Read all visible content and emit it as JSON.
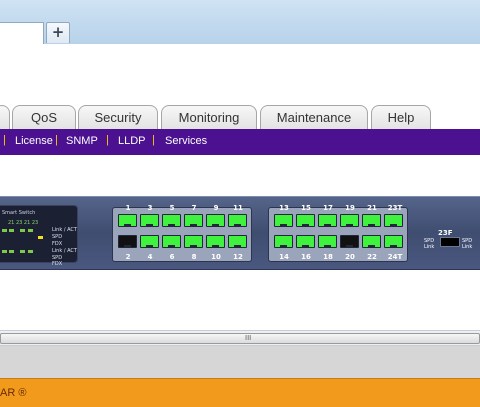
{
  "browser": {
    "new_tab_label": "+"
  },
  "nav": {
    "tabs": [
      {
        "label": ""
      },
      {
        "label": "QoS"
      },
      {
        "label": "Security"
      },
      {
        "label": "Monitoring"
      },
      {
        "label": "Maintenance"
      },
      {
        "label": "Help"
      }
    ],
    "sub_items": [
      {
        "label": "License"
      },
      {
        "label": "SNMP"
      },
      {
        "label": "LLDP"
      },
      {
        "label": "Services"
      }
    ],
    "separator": "|"
  },
  "switch": {
    "panel_title": "Smart Switch",
    "led_numbers": "21  23  21  23",
    "led_labels": [
      "Link / ACT",
      "SPD",
      "FDX",
      "Link / ACT",
      "SPD",
      "FDX"
    ],
    "port_numbers_top_a": [
      "1",
      "3",
      "5",
      "7",
      "9",
      "11"
    ],
    "port_numbers_bottom_a": [
      "2",
      "4",
      "6",
      "8",
      "10",
      "12"
    ],
    "port_numbers_top_b": [
      "13",
      "15",
      "17",
      "19",
      "21"
    ],
    "port_numbers_bottom_b": [
      "14",
      "16",
      "18",
      "20",
      "22"
    ],
    "label_23t": "23T",
    "label_24t": "24T",
    "label_23f": "23F",
    "sfp_label": "SPD Link",
    "port_states_top_a": [
      "up",
      "up",
      "up",
      "up",
      "up",
      "up"
    ],
    "port_states_bottom_a": [
      "down",
      "up",
      "up",
      "up",
      "up",
      "up"
    ],
    "port_states_top_b": [
      "up",
      "up",
      "up",
      "up",
      "up",
      "up"
    ],
    "port_states_bottom_b": [
      "up",
      "up",
      "up",
      "down",
      "up",
      "up"
    ]
  },
  "scrollbar": {
    "grip": "III"
  },
  "footer": {
    "text": "AR ®"
  },
  "colors": {
    "accent": "#4b1190",
    "footer": "#f29a1b",
    "port_up": "#3ef23e"
  }
}
